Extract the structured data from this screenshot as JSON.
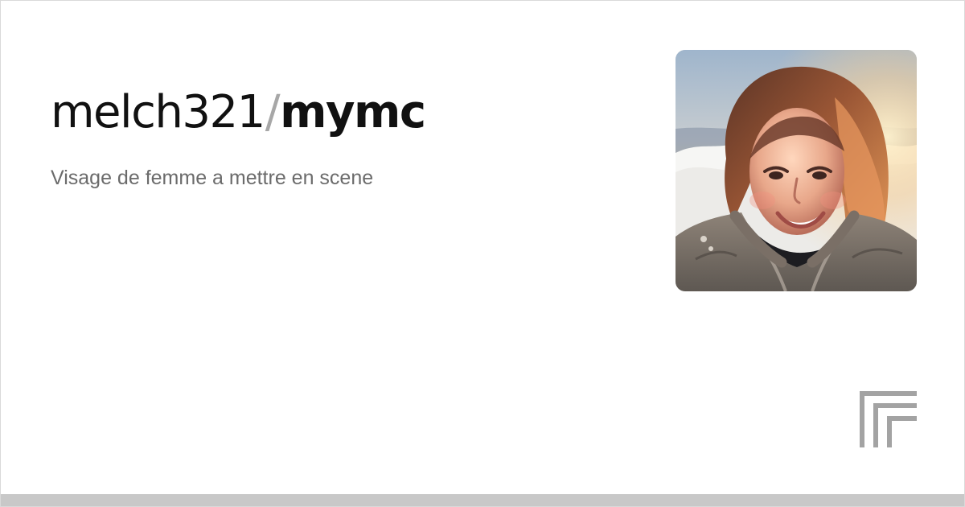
{
  "repository": {
    "owner": "melch321",
    "separator": "/",
    "name": "mymc",
    "description": "Visage de femme a mettre en scene"
  },
  "avatar": {
    "alt": "Portrait"
  },
  "brand": {
    "logo_icon": "replicate-logo-icon"
  },
  "colors": {
    "background": "#ffffff",
    "title": "#111111",
    "separator": "#a7a7a7",
    "description": "#6b6b6b",
    "logo": "#a3a3a3",
    "footer_bar": "#c8c8c8"
  }
}
